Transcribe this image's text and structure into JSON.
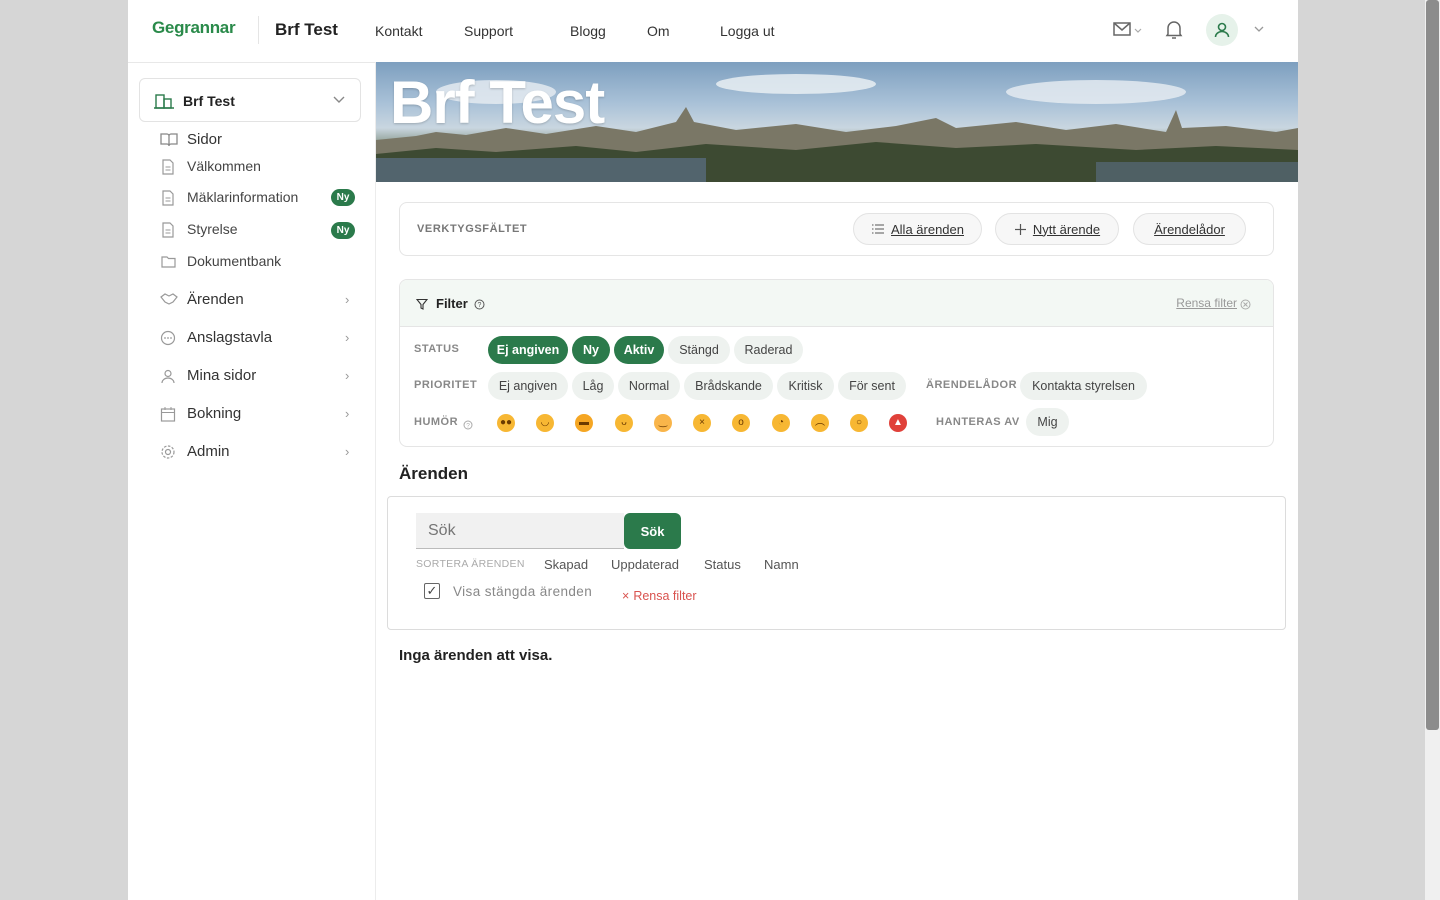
{
  "logo": "Gegrannar",
  "header": {
    "brand": "Brf Test",
    "nav": [
      "Kontakt",
      "Support",
      "Blogg",
      "Om",
      "Logga ut"
    ]
  },
  "sidebar": {
    "org": "Brf Test",
    "pages_label": "Sidor",
    "pages": [
      {
        "label": "Välkommen",
        "badge": ""
      },
      {
        "label": "Mäklarinformation",
        "badge": "Ny"
      },
      {
        "label": "Styrelse",
        "badge": "Ny"
      },
      {
        "label": "Dokumentbank",
        "badge": ""
      }
    ],
    "sections": [
      "Ärenden",
      "Anslagstavla",
      "Mina sidor",
      "Bokning",
      "Admin"
    ]
  },
  "hero": {
    "title": "Brf Test"
  },
  "toolbar": {
    "title": "VERKTYGSFÄLTET",
    "all": "Alla ärenden",
    "new": "Nytt ärende",
    "boxes": "Ärendelådor"
  },
  "filter": {
    "title": "Filter",
    "clear": "Rensa filter",
    "status_label": "STATUS",
    "status": [
      "Ej angiven",
      "Ny",
      "Aktiv",
      "Stängd",
      "Raderad"
    ],
    "priority_label": "PRIORITET",
    "priority": [
      "Ej angiven",
      "Låg",
      "Normal",
      "Brådskande",
      "Kritisk",
      "För sent"
    ],
    "boxes_label": "ÄRENDELÅDOR",
    "boxes": [
      "Kontakta styrelsen"
    ],
    "mood_label": "HUMÖR",
    "handled_label": "HANTERAS AV",
    "handled": [
      "Mig"
    ]
  },
  "cases": {
    "title": "Ärenden",
    "search_placeholder": "Sök",
    "search_button": "Sök",
    "sort_label": "SORTERA ÄRENDEN",
    "sort_options": [
      "Skapad",
      "Uppdaterad",
      "Status",
      "Namn"
    ],
    "show_closed": "Visa stängda ärenden",
    "clear": "Rensa filter",
    "empty": "Inga ärenden att visa."
  }
}
